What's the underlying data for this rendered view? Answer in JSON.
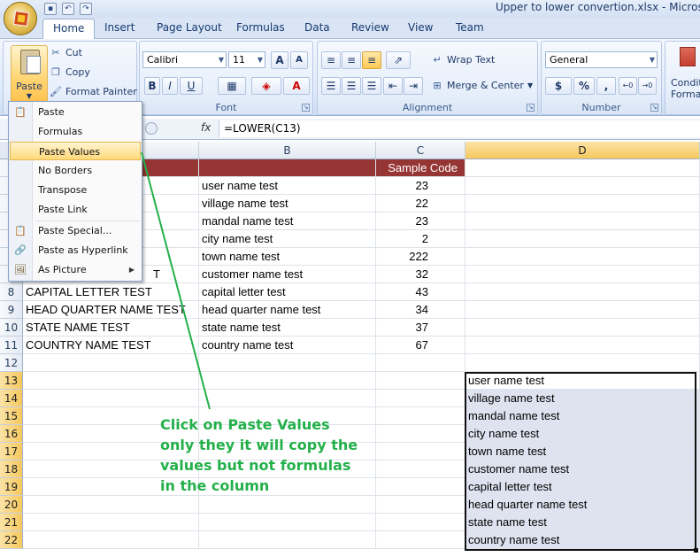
{
  "window": {
    "title": "Upper to lower convertion.xlsx - Microsoft E"
  },
  "tabs": [
    "Home",
    "Insert",
    "Page Layout",
    "Formulas",
    "Data",
    "Review",
    "View",
    "Team"
  ],
  "clipboard": {
    "paste_label": "Paste",
    "cut": "Cut",
    "copy": "Copy",
    "format_painter": "Format Painter"
  },
  "font": {
    "name": "Calibri",
    "size": "11",
    "group_label": "Font"
  },
  "alignment": {
    "wrap_text": "Wrap Text",
    "merge_center": "Merge & Center",
    "group_label": "Alignment"
  },
  "number": {
    "format": "General",
    "group_label": "Number",
    "currency": "$",
    "percent": "%",
    "comma": ","
  },
  "styles": {
    "conditional_line1": "Conditi",
    "conditional_line2": "Format"
  },
  "formula_bar": {
    "fx": "fx",
    "formula": "=LOWER(C13)"
  },
  "columns": {
    "b": "B",
    "c": "C",
    "d": "D"
  },
  "header_row": {
    "c": "Sample Code"
  },
  "rows": [
    {
      "num": "",
      "a": "",
      "b": "user name test",
      "c": "23"
    },
    {
      "num": "",
      "a": "",
      "b": "village name test",
      "c": "22"
    },
    {
      "num": "",
      "a": "",
      "b": "mandal name test",
      "c": "23"
    },
    {
      "num": "",
      "a": "",
      "b": "city name test",
      "c": "2"
    },
    {
      "num": "",
      "a": "",
      "b": "town name test",
      "c": "222"
    },
    {
      "num": "",
      "a": "T",
      "b": "customer name test",
      "c": "32"
    },
    {
      "num": "8",
      "a": "CAPITAL LETTER TEST",
      "b": "capital letter test",
      "c": "43"
    },
    {
      "num": "9",
      "a": "HEAD QUARTER NAME TEST",
      "b": "head quarter name test",
      "c": "34"
    },
    {
      "num": "10",
      "a": "STATE NAME TEST",
      "b": "state name test",
      "c": "37"
    },
    {
      "num": "11",
      "a": "COUNTRY NAME TEST",
      "b": "country name test",
      "c": "67"
    }
  ],
  "lower_rows": [
    {
      "num": "12",
      "d": ""
    },
    {
      "num": "13",
      "d": "user name test"
    },
    {
      "num": "14",
      "d": "village name test"
    },
    {
      "num": "15",
      "d": "mandal name test"
    },
    {
      "num": "16",
      "d": "city name test"
    },
    {
      "num": "17",
      "d": "town name test"
    },
    {
      "num": "18",
      "d": "customer name test"
    },
    {
      "num": "19",
      "d": "capital letter test"
    },
    {
      "num": "20",
      "d": "head quarter name test"
    },
    {
      "num": "21",
      "d": "state name test"
    },
    {
      "num": "22",
      "d": "country name test"
    }
  ],
  "paste_menu": [
    {
      "label": "Paste",
      "icon": "paste-icon"
    },
    {
      "label": "Formulas",
      "icon": ""
    },
    {
      "label": "Paste Values",
      "icon": ""
    },
    {
      "label": "No Borders",
      "icon": ""
    },
    {
      "label": "Transpose",
      "icon": ""
    },
    {
      "label": "Paste Link",
      "icon": ""
    },
    {
      "label": "Paste Special...",
      "icon": "paste-special-icon"
    },
    {
      "label": "Paste as Hyperlink",
      "icon": "hyperlink-icon"
    },
    {
      "label": "As Picture",
      "icon": "picture-icon"
    }
  ],
  "annotation": {
    "line1": "Click on Paste Values",
    "line2": "only they it will copy the",
    "line3": "values but not formulas",
    "line4": "in the column"
  },
  "colors": {
    "accent_header": "#963634",
    "annotation": "#23b04a",
    "highlight": "#ffd97a"
  }
}
